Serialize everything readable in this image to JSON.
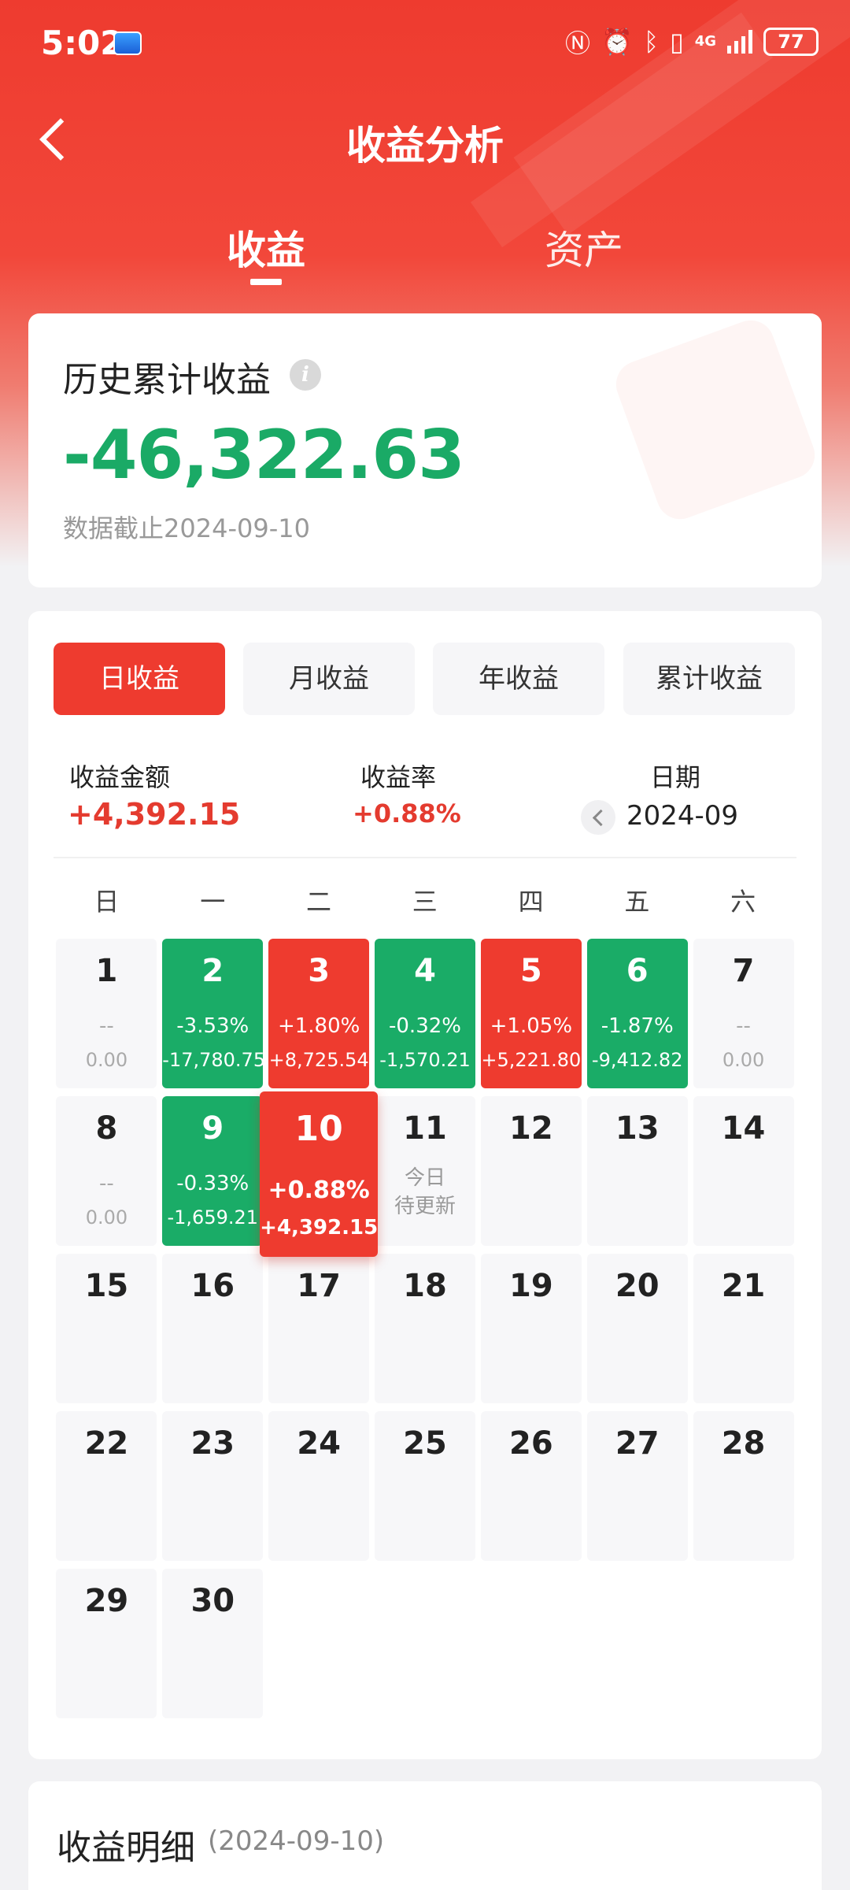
{
  "status_bar": {
    "time": "5:02",
    "network": "4G",
    "battery": "77"
  },
  "header": {
    "title": "收益分析",
    "tabs": [
      {
        "label": "收益",
        "active": true
      },
      {
        "label": "资产",
        "active": false
      }
    ]
  },
  "summary": {
    "label": "历史累计收益",
    "value": "-46,322.63",
    "date_note": "数据截止2024-09-10"
  },
  "segments": [
    {
      "label": "日收益",
      "active": true
    },
    {
      "label": "月收益",
      "active": false
    },
    {
      "label": "年收益",
      "active": false
    },
    {
      "label": "累计收益",
      "active": false
    }
  ],
  "stats": {
    "amount_label": "收益金额",
    "amount_value": "+4,392.15",
    "rate_label": "收益率",
    "rate_value": "+0.88%",
    "date_label": "日期",
    "date_value": "2024-09"
  },
  "calendar": {
    "weekdays": [
      "日",
      "一",
      "二",
      "三",
      "四",
      "五",
      "六"
    ],
    "today_line1": "今日",
    "today_line2": "待更新",
    "days": [
      {
        "d": "1",
        "pct": "--",
        "amt": "0.00",
        "state": "dash"
      },
      {
        "d": "2",
        "pct": "-3.53%",
        "amt": "-17,780.75",
        "state": "green"
      },
      {
        "d": "3",
        "pct": "+1.80%",
        "amt": "+8,725.54",
        "state": "red"
      },
      {
        "d": "4",
        "pct": "-0.32%",
        "amt": "-1,570.21",
        "state": "green"
      },
      {
        "d": "5",
        "pct": "+1.05%",
        "amt": "+5,221.80",
        "state": "red"
      },
      {
        "d": "6",
        "pct": "-1.87%",
        "amt": "-9,412.82",
        "state": "green"
      },
      {
        "d": "7",
        "pct": "--",
        "amt": "0.00",
        "state": "dash"
      },
      {
        "d": "8",
        "pct": "--",
        "amt": "0.00",
        "state": "dash"
      },
      {
        "d": "9",
        "pct": "-0.33%",
        "amt": "-1,659.21",
        "state": "green"
      },
      {
        "d": "10",
        "pct": "+0.88%",
        "amt": "+4,392.15",
        "state": "red",
        "selected": true
      },
      {
        "d": "11",
        "state": "today"
      },
      {
        "d": "12",
        "state": "plain"
      },
      {
        "d": "13",
        "state": "plain"
      },
      {
        "d": "14",
        "state": "plain"
      },
      {
        "d": "15",
        "state": "plain"
      },
      {
        "d": "16",
        "state": "plain"
      },
      {
        "d": "17",
        "state": "plain"
      },
      {
        "d": "18",
        "state": "plain"
      },
      {
        "d": "19",
        "state": "plain"
      },
      {
        "d": "20",
        "state": "plain"
      },
      {
        "d": "21",
        "state": "plain"
      },
      {
        "d": "22",
        "state": "plain"
      },
      {
        "d": "23",
        "state": "plain"
      },
      {
        "d": "24",
        "state": "plain"
      },
      {
        "d": "25",
        "state": "plain"
      },
      {
        "d": "26",
        "state": "plain"
      },
      {
        "d": "27",
        "state": "plain"
      },
      {
        "d": "28",
        "state": "plain"
      },
      {
        "d": "29",
        "state": "plain"
      },
      {
        "d": "30",
        "state": "plain"
      }
    ]
  },
  "detail": {
    "title": "收益明细",
    "date": "(2024-09-10)"
  },
  "colors": {
    "brand_red": "#ee3b2f",
    "profit_green": "#1aac67",
    "loss_text": "#e43b2f"
  }
}
